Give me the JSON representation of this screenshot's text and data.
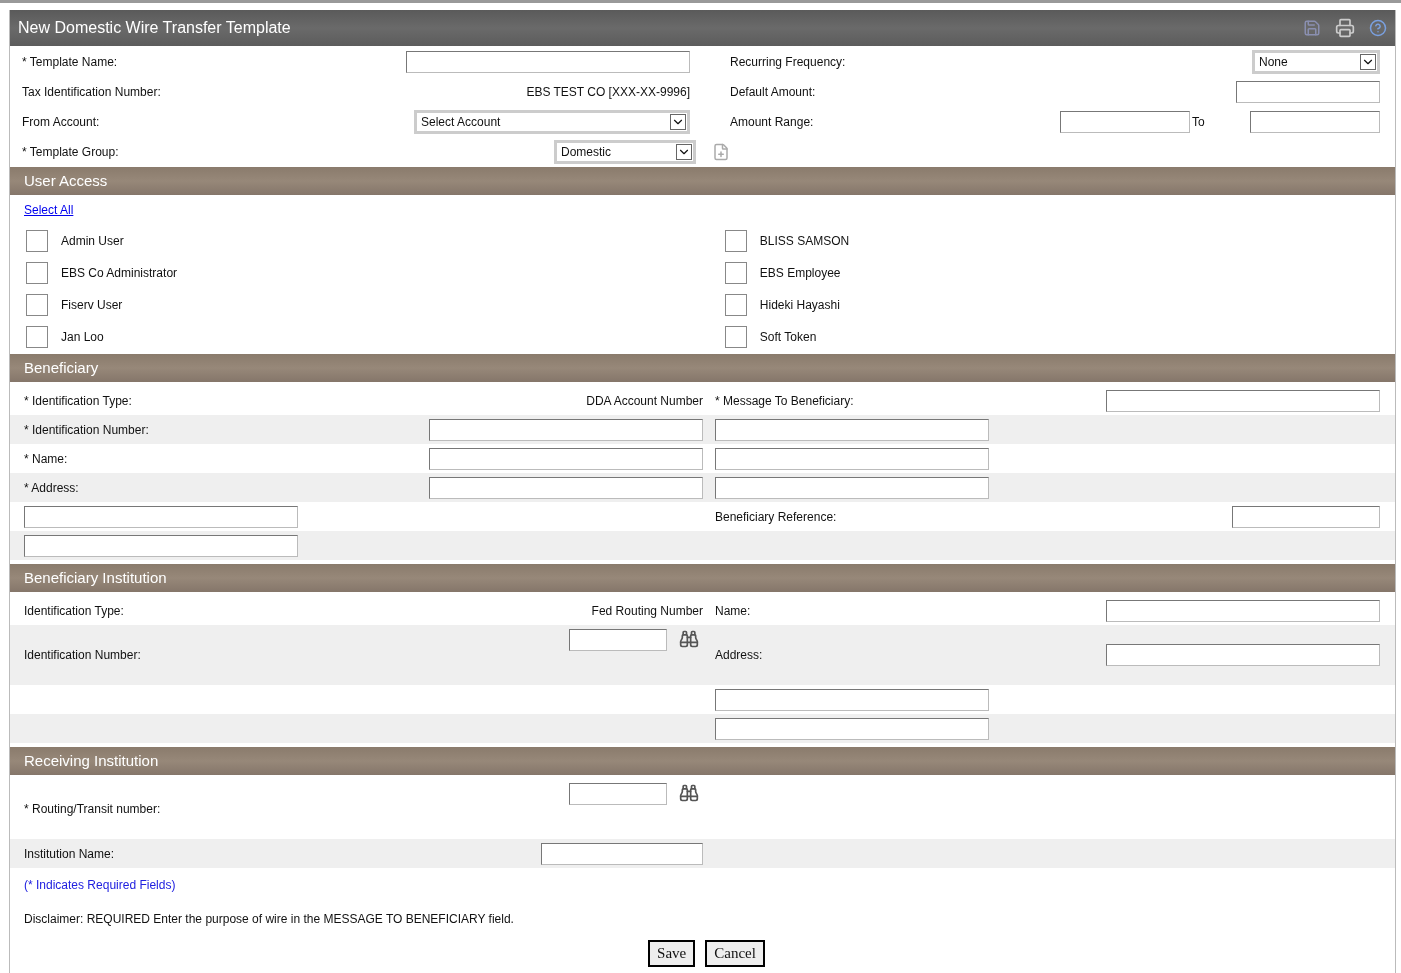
{
  "window": {
    "title": "New Domestic Wire Transfer Template"
  },
  "template": {
    "left": [
      {
        "kind": "input",
        "label": "* Template Name:"
      },
      {
        "kind": "text",
        "label": "Tax Identification Number:",
        "value": "EBS TEST CO [XXX-XX-9996]"
      },
      {
        "kind": "select",
        "label": "From Account:",
        "value": "Select Account"
      },
      {
        "kind": "select_add",
        "label": "* Template Group:",
        "value": "Domestic"
      }
    ],
    "right": [
      {
        "kind": "select",
        "label": "Recurring Frequency:",
        "value": "None"
      },
      {
        "kind": "input",
        "label": "Default Amount:"
      },
      {
        "kind": "range",
        "label": "Amount Range:",
        "separator": "To"
      }
    ]
  },
  "user_access": {
    "title": "User Access",
    "select_all": "Select All",
    "users": [
      {
        "name": "Admin User",
        "checked": false
      },
      {
        "name": "EBS Co Administrator",
        "checked": false
      },
      {
        "name": "Fiserv User",
        "checked": false
      },
      {
        "name": "Jan Loo",
        "checked": false
      },
      {
        "name": "BLISS SAMSON",
        "checked": false
      },
      {
        "name": "EBS Employee",
        "checked": false
      },
      {
        "name": "Hideki Hayashi",
        "checked": false
      },
      {
        "name": "Soft Token",
        "checked": false
      }
    ]
  },
  "sections": [
    {
      "title": "Beneficiary",
      "rows": [
        {
          "left": {
            "kind": "text",
            "label": "* Identification Type:",
            "value": "DDA Account Number"
          },
          "right": {
            "kind": "input",
            "label": "* Message To Beneficiary:"
          }
        },
        {
          "left": {
            "kind": "input",
            "label": "* Identification Number:"
          },
          "right": {
            "kind": "input"
          }
        },
        {
          "left": {
            "kind": "input",
            "label": "* Name:"
          },
          "right": {
            "kind": "input"
          }
        },
        {
          "left": {
            "kind": "input",
            "label": "* Address:"
          },
          "right": {
            "kind": "input"
          }
        },
        {
          "left": {
            "kind": "input"
          },
          "right": {
            "kind": "short_input",
            "label": "Beneficiary Reference:"
          }
        },
        {
          "left": {
            "kind": "input"
          },
          "right": {
            "kind": "none"
          }
        }
      ]
    },
    {
      "title": "Beneficiary Institution",
      "rows": [
        {
          "left": {
            "kind": "text",
            "label": "Identification Type:",
            "value": "Fed Routing Number"
          },
          "right": {
            "kind": "input",
            "label": "Name:"
          }
        },
        {
          "left": {
            "kind": "lookup",
            "label": "Identification Number:"
          },
          "right": {
            "kind": "input",
            "label": "Address:"
          }
        },
        {
          "left": {
            "kind": "none"
          },
          "right": {
            "kind": "input"
          }
        },
        {
          "left": {
            "kind": "none"
          },
          "right": {
            "kind": "input"
          }
        }
      ]
    },
    {
      "title": "Receiving Institution",
      "rows": [
        {
          "left": {
            "kind": "lookup",
            "label": "* Routing/Transit number:"
          },
          "right": {
            "kind": "none"
          }
        },
        {
          "left": {
            "kind": "short_input",
            "label": "Institution Name:"
          },
          "right": {
            "kind": "none"
          }
        }
      ]
    }
  ],
  "required_note": "(* Indicates Required Fields)",
  "disclaimer": "Disclaimer: REQUIRED Enter the purpose of wire in the MESSAGE TO BENEFICIARY field.",
  "buttons": [
    "Save",
    "Cancel"
  ]
}
